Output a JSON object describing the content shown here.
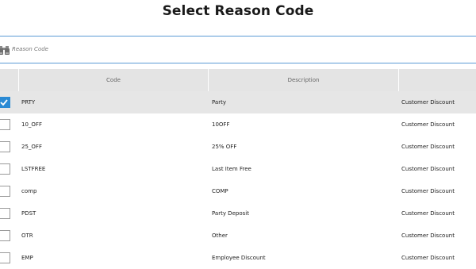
{
  "title": "Select Reason Code",
  "search": {
    "placeholder": "Reason Code",
    "value": ""
  },
  "table": {
    "columns": [
      "Code",
      "Description",
      ""
    ],
    "rows": [
      {
        "checked": true,
        "code": "PRTY",
        "description": "Party",
        "type": "Customer Discount"
      },
      {
        "checked": false,
        "code": "10_OFF",
        "description": "10OFF",
        "type": "Customer Discount"
      },
      {
        "checked": false,
        "code": "25_OFF",
        "description": "25% OFF",
        "type": "Customer Discount"
      },
      {
        "checked": false,
        "code": "LSTFREE",
        "description": "Last Item Free",
        "type": "Customer Discount"
      },
      {
        "checked": false,
        "code": "comp",
        "description": "COMP",
        "type": "Customer Discount"
      },
      {
        "checked": false,
        "code": "PDST",
        "description": "Party Deposit",
        "type": "Customer Discount"
      },
      {
        "checked": false,
        "code": "OTR",
        "description": "Other",
        "type": "Customer Discount"
      },
      {
        "checked": false,
        "code": "EMP",
        "description": "Employee Discount",
        "type": "Customer Discount"
      }
    ]
  },
  "colors": {
    "accent": "#2a8ad4",
    "header_bg": "#e4e4e4",
    "selected_bg": "#e6e6e6",
    "rule": "#5b9bd5"
  },
  "icons": {
    "search": "binoculars-icon",
    "checkbox": "checkmark-icon"
  }
}
